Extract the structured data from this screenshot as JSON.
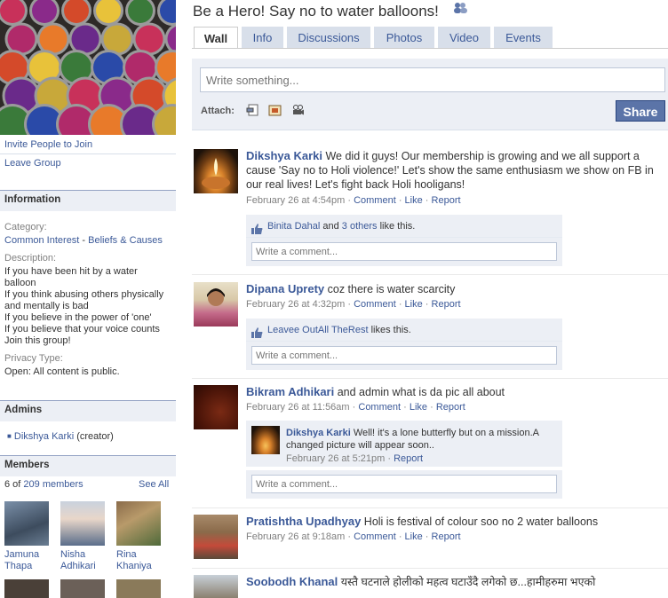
{
  "group": {
    "title": "Be a Hero! Say no to water balloons!",
    "group_icon": "people-icon"
  },
  "left": {
    "invite": "Invite People to Join",
    "leave": "Leave Group",
    "info_header": "Information",
    "category_label": "Category:",
    "category_1": "Common Interest",
    "category_dash": " - ",
    "category_2": "Beliefs & Causes",
    "description_label": "Description:",
    "description_lines": [
      "If you have been hit by a water balloon",
      "If you think abusing others physically and mentally is bad",
      "If you believe in the power of 'one'",
      "If you believe that your voice counts",
      "Join this group!"
    ],
    "privacy_label": "Privacy Type:",
    "privacy_value": "Open: All content is public.",
    "admins_header": "Admins",
    "admin_name": "Dikshya Karki",
    "admin_role": " (creator)",
    "members_header": "Members",
    "members_prefix": "6 of ",
    "members_count": "209 members",
    "see_all": "See All",
    "members": [
      {
        "first": "Jamuna",
        "last": "Thapa"
      },
      {
        "first": "Nisha",
        "last": "Adhikari"
      },
      {
        "first": "Rina",
        "last": "Khaniya"
      }
    ]
  },
  "tabs": [
    {
      "label": "Wall",
      "active": true
    },
    {
      "label": "Info"
    },
    {
      "label": "Discussions"
    },
    {
      "label": "Photos"
    },
    {
      "label": "Video"
    },
    {
      "label": "Events"
    }
  ],
  "composer": {
    "placeholder": "Write something...",
    "attach_label": "Attach:",
    "share_label": "Share",
    "attach_icons": [
      "link-icon",
      "photo-icon",
      "video-icon"
    ]
  },
  "actions": {
    "comment": "Comment",
    "like": "Like",
    "report": "Report",
    "dot": " · "
  },
  "comment_placeholder": "Write a comment...",
  "posts": [
    {
      "author": "Dikshya Karki",
      "text": " We did it guys! Our membership is growing and we all support a cause 'Say no to Holi violence!' Let's show the same enthusiasm we show on FB in our real lives! Let's fight back Holi hooligans!",
      "time": "February 26 at 4:54pm",
      "likes": {
        "name": "Binita Dahal",
        "and": " and ",
        "others": "3 others",
        "suffix": " like this."
      }
    },
    {
      "author": "Dipana Uprety",
      "text": " coz there is water scarcity",
      "time": "February 26 at 4:32pm",
      "likes": {
        "name": "Leavee OutAll TheRest",
        "suffix": " likes this."
      }
    },
    {
      "author": "Bikram Adhikari",
      "text": " and admin what is da pic all about",
      "time": "February 26 at 11:56am",
      "reply": {
        "author": "Dikshya Karki",
        "text": " Well! it's a lone butterfly but on a mission.A changed picture will appear soon..",
        "time": "February 26 at 5:21pm",
        "report": "Report"
      }
    },
    {
      "author": "Pratishtha Upadhyay",
      "text": " Holi is festival of colour soo no 2 water balloons",
      "time": "February 26 at 9:18am"
    },
    {
      "author": "Soobodh Khanal",
      "text": " यस्तै घटनाले होलीको महत्व घटाउँदै लगेको छ...हामीहरुमा भएको"
    }
  ],
  "colors": {
    "link": "#3b5998",
    "panel": "#eceff5",
    "share": "#5b74a8",
    "border": "#d8dfea"
  }
}
